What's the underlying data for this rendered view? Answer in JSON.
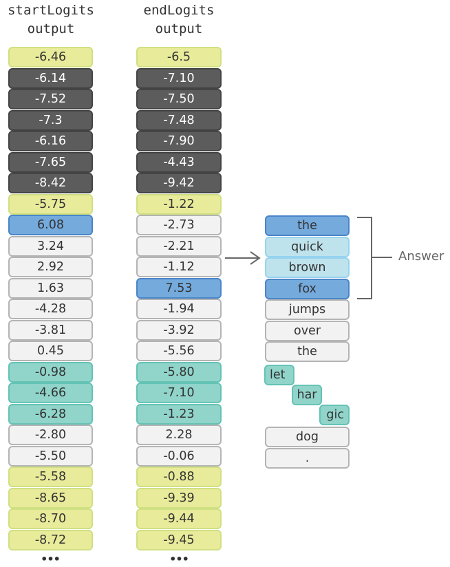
{
  "headers": {
    "start": "startLogits\noutput",
    "end": "endLogits\noutput"
  },
  "start_logits": [
    {
      "value": "-6.46",
      "style": "yellow"
    },
    {
      "value": "-6.14",
      "style": "dark"
    },
    {
      "value": "-7.52",
      "style": "dark"
    },
    {
      "value": "-7.3",
      "style": "dark"
    },
    {
      "value": "-6.16",
      "style": "dark"
    },
    {
      "value": "-7.65",
      "style": "dark"
    },
    {
      "value": "-8.42",
      "style": "dark"
    },
    {
      "value": "-5.75",
      "style": "yellow"
    },
    {
      "value": "6.08",
      "style": "blue"
    },
    {
      "value": "3.24",
      "style": "white"
    },
    {
      "value": "2.92",
      "style": "white"
    },
    {
      "value": "1.63",
      "style": "white"
    },
    {
      "value": "-4.28",
      "style": "white"
    },
    {
      "value": "-3.81",
      "style": "white"
    },
    {
      "value": "0.45",
      "style": "white"
    },
    {
      "value": "-0.98",
      "style": "teal"
    },
    {
      "value": "-4.66",
      "style": "teal"
    },
    {
      "value": "-6.28",
      "style": "teal"
    },
    {
      "value": "-2.80",
      "style": "white"
    },
    {
      "value": "-5.50",
      "style": "white"
    },
    {
      "value": "-5.58",
      "style": "yellow"
    },
    {
      "value": "-8.65",
      "style": "yellow"
    },
    {
      "value": "-8.70",
      "style": "yellow"
    },
    {
      "value": "-8.72",
      "style": "yellow"
    }
  ],
  "end_logits": [
    {
      "value": "-6.5",
      "style": "yellow"
    },
    {
      "value": "-7.10",
      "style": "dark"
    },
    {
      "value": "-7.50",
      "style": "dark"
    },
    {
      "value": "-7.48",
      "style": "dark"
    },
    {
      "value": "-7.90",
      "style": "dark"
    },
    {
      "value": "-4.43",
      "style": "dark"
    },
    {
      "value": "-9.42",
      "style": "dark"
    },
    {
      "value": "-1.22",
      "style": "yellow"
    },
    {
      "value": "-2.73",
      "style": "white"
    },
    {
      "value": "-2.21",
      "style": "white"
    },
    {
      "value": "-1.12",
      "style": "white"
    },
    {
      "value": "7.53",
      "style": "blue"
    },
    {
      "value": "-1.94",
      "style": "white"
    },
    {
      "value": "-3.92",
      "style": "white"
    },
    {
      "value": "-5.56",
      "style": "white"
    },
    {
      "value": "-5.80",
      "style": "teal"
    },
    {
      "value": "-7.10",
      "style": "teal"
    },
    {
      "value": "-1.23",
      "style": "teal"
    },
    {
      "value": "2.28",
      "style": "white"
    },
    {
      "value": "-0.06",
      "style": "white"
    },
    {
      "value": "-0.88",
      "style": "yellow"
    },
    {
      "value": "-9.39",
      "style": "yellow"
    },
    {
      "value": "-9.44",
      "style": "yellow"
    },
    {
      "value": "-9.45",
      "style": "yellow"
    }
  ],
  "ellipsis": "•••",
  "tokens": [
    {
      "text": "the",
      "style": "blue",
      "kind": "full"
    },
    {
      "text": "quick",
      "style": "lightblue",
      "kind": "full"
    },
    {
      "text": "brown",
      "style": "lightblue",
      "kind": "full"
    },
    {
      "text": "fox",
      "style": "blue",
      "kind": "full"
    },
    {
      "text": "jumps",
      "style": "white",
      "kind": "full"
    },
    {
      "text": "over",
      "style": "white",
      "kind": "full"
    },
    {
      "text": "the",
      "style": "white",
      "kind": "full"
    },
    {
      "text": "let",
      "style": "teal",
      "kind": "sub-1"
    },
    {
      "text": "har",
      "style": "teal",
      "kind": "sub-2"
    },
    {
      "text": "gic",
      "style": "teal",
      "kind": "sub-3"
    },
    {
      "text": "dog",
      "style": "white",
      "kind": "full"
    },
    {
      "text": ".",
      "style": "white",
      "kind": "full"
    }
  ],
  "answer_label": "Answer",
  "colors": {
    "yellow": "#e8eb9a",
    "dark": "#5c5c5c",
    "blue": "#75aadd",
    "lightblue": "#bfe3ec",
    "teal": "#90d4ca",
    "white": "#f2f2f2",
    "connector": "#666666"
  }
}
